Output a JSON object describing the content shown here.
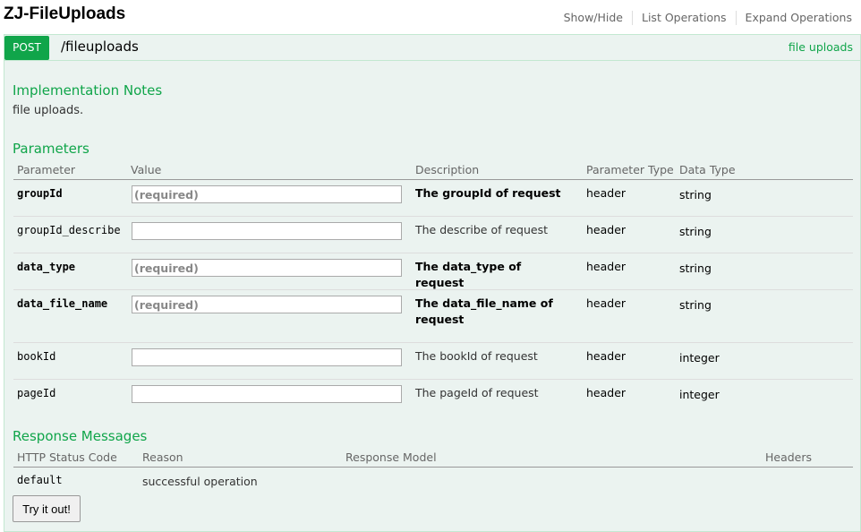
{
  "header": {
    "title": "ZJ-FileUploads",
    "links": [
      "Show/Hide",
      "List Operations",
      "Expand Operations"
    ]
  },
  "operation": {
    "method": "POST",
    "path": "/fileuploads",
    "summary": "file uploads"
  },
  "implementation_notes": {
    "title": "Implementation Notes",
    "text": "file uploads."
  },
  "parameters": {
    "title": "Parameters",
    "columns": [
      "Parameter",
      "Value",
      "Description",
      "Parameter Type",
      "Data Type"
    ],
    "rows": [
      {
        "name": "groupId",
        "required": true,
        "placeholder": "(required)",
        "description": "The groupId of request",
        "param_type": "header",
        "data_type": "string"
      },
      {
        "name": "groupId_describe",
        "required": false,
        "placeholder": "",
        "description": "The describe of request",
        "param_type": "header",
        "data_type": "string"
      },
      {
        "name": "data_type",
        "required": true,
        "placeholder": "(required)",
        "description": "The data_type of request",
        "param_type": "header",
        "data_type": "string"
      },
      {
        "name": "data_file_name",
        "required": true,
        "placeholder": "(required)",
        "description": "The data_file_name of request",
        "param_type": "header",
        "data_type": "string"
      },
      {
        "name": "bookId",
        "required": false,
        "placeholder": "",
        "description": "The bookId of request",
        "param_type": "header",
        "data_type": "integer"
      },
      {
        "name": "pageId",
        "required": false,
        "placeholder": "",
        "description": "The pageId of request",
        "param_type": "header",
        "data_type": "integer"
      }
    ]
  },
  "responses": {
    "title": "Response Messages",
    "columns": [
      "HTTP Status Code",
      "Reason",
      "Response Model",
      "Headers"
    ],
    "rows": [
      {
        "code": "default",
        "reason": "successful operation"
      }
    ]
  },
  "try_button": "Try it out!",
  "colors": {
    "accent": "#10a54a",
    "panel_bg": "#ebf3f0",
    "panel_border": "#c3e8d1"
  }
}
